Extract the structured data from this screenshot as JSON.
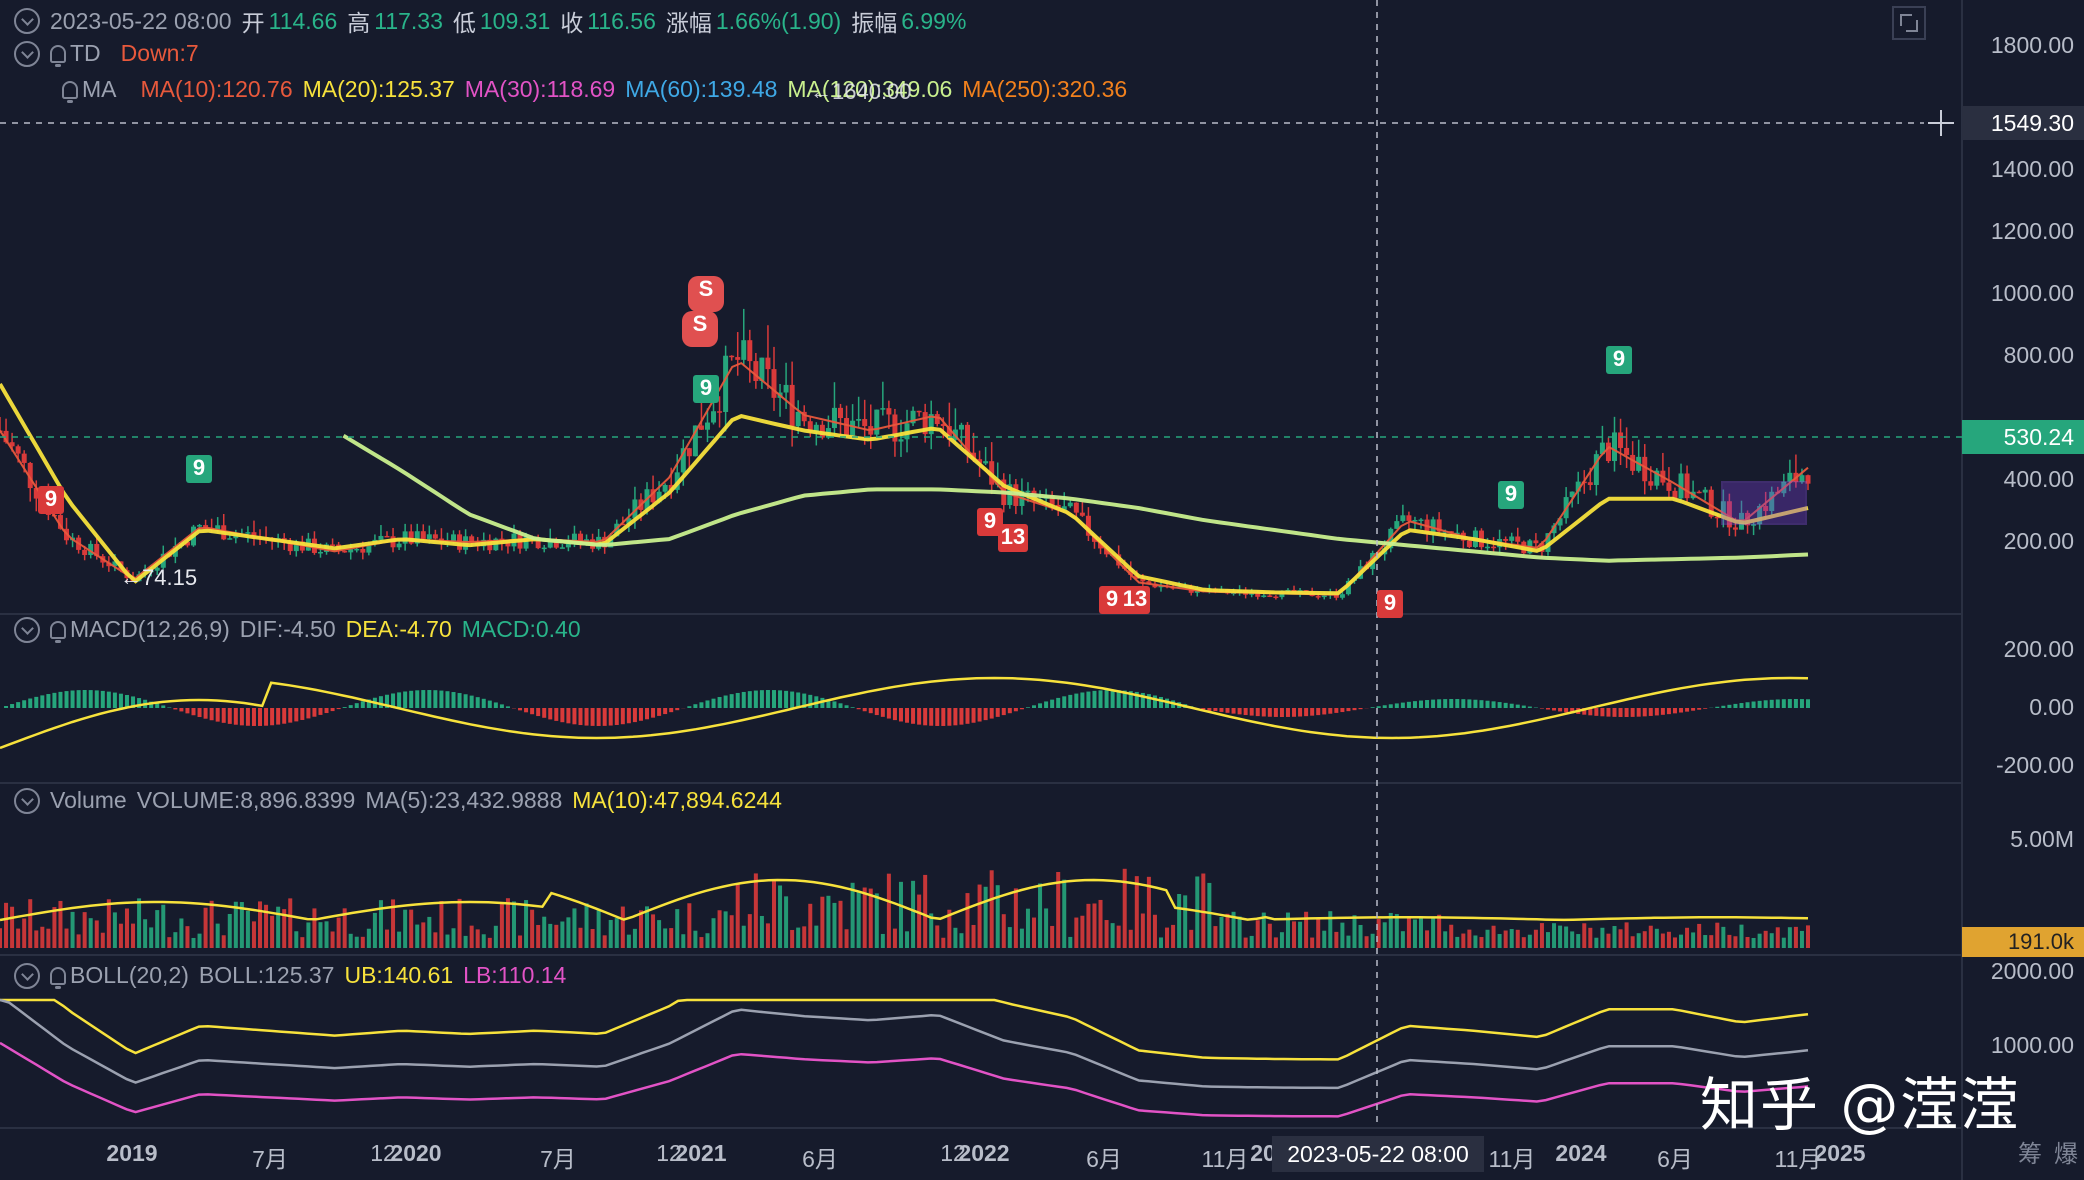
{
  "header": {
    "datetime": "2023-05-22 08:00",
    "open_label": "开",
    "open": "114.66",
    "high_label": "高",
    "high": "117.33",
    "low_label": "低",
    "low": "109.31",
    "close_label": "收",
    "close": "116.56",
    "change_label": "涨幅",
    "change": "1.66%(1.90)",
    "amp_label": "振幅",
    "amp": "6.99%"
  },
  "td": {
    "label": "TD",
    "value": "Down:7"
  },
  "ma": {
    "label": "MA",
    "items": [
      {
        "text": "MA(10):120.76",
        "color": "#e8593c"
      },
      {
        "text": "MA(20):125.37",
        "color": "#f7e23c"
      },
      {
        "text": "MA(30):118.69",
        "color": "#e253c6"
      },
      {
        "text": "MA(60):139.48",
        "color": "#3fa9e6"
      },
      {
        "text": "MA(120):349.06",
        "color": "#c9f08e"
      },
      {
        "text": "MA(250):320.36",
        "color": "#f2811d"
      }
    ]
  },
  "macd": {
    "label": "MACD(12,26,9)",
    "dif": "DIF:-4.50",
    "dea": "DEA:-4.70",
    "macd": "MACD:0.40"
  },
  "volume": {
    "label": "Volume",
    "vol": "VOLUME:8,896.8399",
    "ma5": "MA(5):23,432.9888",
    "ma10": "MA(10):47,894.6244"
  },
  "boll": {
    "label": "BOLL(20,2)",
    "boll": "BOLL:125.37",
    "ub": "UB:140.61",
    "lb": "LB:110.14"
  },
  "price_axis": {
    "ticks": [
      "1800.00",
      "1400.00",
      "1200.00",
      "1000.00",
      "800.00",
      "400.00",
      "200.00"
    ],
    "crosshair": "1549.30",
    "last": "530.24"
  },
  "macd_axis": {
    "ticks": [
      "200.00",
      "0.00",
      "-200.00"
    ]
  },
  "volume_axis": {
    "ticks": [
      "5.00M"
    ],
    "last": "191.0k"
  },
  "boll_axis": {
    "ticks": [
      "2000.00",
      "1000.00"
    ]
  },
  "time_axis": {
    "labels": [
      "2019",
      "7月",
      "12",
      "2020",
      "7月",
      "12",
      "2021",
      "6月",
      "12",
      "2022",
      "6月",
      "11月",
      "20",
      "11月",
      "2024",
      "6月",
      "11月",
      "2025"
    ],
    "crosshair": "2023-05-22 08:00"
  },
  "annotations": {
    "low_marker": "←74.15",
    "high_marker": "←1640.00"
  },
  "td_tags": {
    "nine": "9",
    "thirteen": "13",
    "sell": "S"
  },
  "bottom_right": {
    "chip": "筹",
    "burst": "爆"
  },
  "watermark": "知乎 @滢滢",
  "chart_data": {
    "type": "candlestick",
    "title": "",
    "y_range": [
      0,
      1900
    ],
    "x": [
      "2018-10",
      "2019-01",
      "2019-04",
      "2019-07",
      "2019-10",
      "2020-01",
      "2020-04",
      "2020-07",
      "2020-10",
      "2021-01",
      "2021-03",
      "2021-05",
      "2021-07",
      "2021-09",
      "2021-11",
      "2022-01",
      "2022-04",
      "2022-07",
      "2022-10",
      "2023-01",
      "2023-04",
      "2023-07",
      "2023-10",
      "2024-01",
      "2024-04",
      "2024-07",
      "2024-10",
      "2025-01"
    ],
    "series": [
      {
        "name": "MA(10)",
        "values": [
          650,
          310,
          170,
          340,
          300,
          260,
          300,
          290,
          300,
          290,
          500,
          880,
          700,
          650,
          700,
          450,
          380,
          160,
          130,
          125,
          120,
          360,
          300,
          270,
          600,
          480,
          350,
          530
        ]
      },
      {
        "name": "MA(20)",
        "values": [
          800,
          430,
          160,
          330,
          300,
          270,
          300,
          280,
          300,
          280,
          450,
          700,
          650,
          620,
          660,
          470,
          380,
          180,
          135,
          128,
          125,
          330,
          300,
          260,
          430,
          430,
          350,
          400
        ]
      },
      {
        "name": "MA(120)",
        "values": [
          null,
          null,
          null,
          null,
          null,
          650,
          520,
          380,
          300,
          280,
          300,
          380,
          440,
          460,
          460,
          450,
          430,
          400,
          360,
          330,
          300,
          280,
          260,
          240,
          230,
          235,
          240,
          250
        ]
      }
    ],
    "volume_range_millions": [
      0,
      6
    ],
    "macd_range": [
      -300,
      300
    ],
    "td_sequence": {
      "nine": "9",
      "thirteen": "13",
      "sell": "S"
    }
  }
}
